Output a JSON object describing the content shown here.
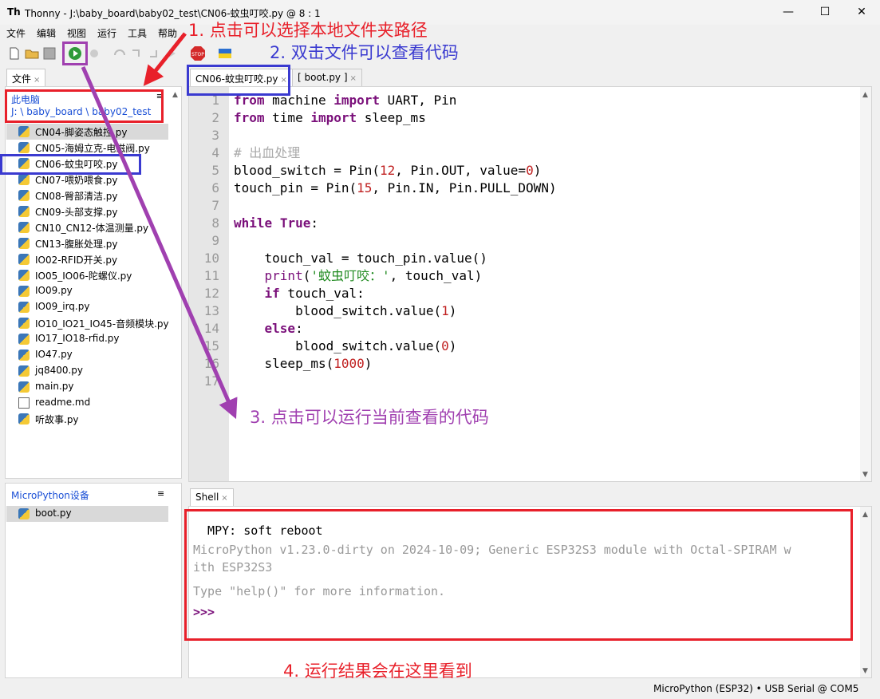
{
  "window": {
    "app_name": "Thonny",
    "title": "J:\\baby_board\\baby02_test\\CN06-蚊虫叮咬.py  @  8 : 1",
    "icon_text": "Th",
    "minimize_glyph": "—",
    "maximize_glyph": "☐",
    "close_glyph": "✕"
  },
  "menu": [
    "文件",
    "编辑",
    "视图",
    "运行",
    "工具",
    "帮助"
  ],
  "files_panel": {
    "tab_label": "文件",
    "location_label": "此电脑",
    "path": "J: \\ baby_board \\ baby02_test",
    "menu_glyph": "≡",
    "files": [
      {
        "name": "CN04-脚姿态触控.py",
        "type": "py",
        "selected": true
      },
      {
        "name": "CN05-海姆立克-电磁阀.py",
        "type": "py"
      },
      {
        "name": "CN06-蚊虫叮咬.py",
        "type": "py"
      },
      {
        "name": "CN07-喂奶喂食.py",
        "type": "py"
      },
      {
        "name": "CN08-臀部清洁.py",
        "type": "py"
      },
      {
        "name": "CN09-头部支撑.py",
        "type": "py"
      },
      {
        "name": "CN10_CN12-体温测量.py",
        "type": "py"
      },
      {
        "name": "CN13-腹胀处理.py",
        "type": "py"
      },
      {
        "name": "IO02-RFID开关.py",
        "type": "py"
      },
      {
        "name": "IO05_IO06-陀螺仪.py",
        "type": "py"
      },
      {
        "name": "IO09.py",
        "type": "py"
      },
      {
        "name": "IO09_irq.py",
        "type": "py"
      },
      {
        "name": "IO10_IO21_IO45-音频模块.py",
        "type": "py"
      },
      {
        "name": "IO17_IO18-rfid.py",
        "type": "py"
      },
      {
        "name": "IO47.py",
        "type": "py"
      },
      {
        "name": "jq8400.py",
        "type": "py"
      },
      {
        "name": "main.py",
        "type": "py"
      },
      {
        "name": "readme.md",
        "type": "md"
      },
      {
        "name": "听故事.py",
        "type": "py"
      }
    ]
  },
  "device_panel": {
    "label": "MicroPython设备",
    "menu_glyph": "≡",
    "files": [
      {
        "name": "boot.py",
        "type": "py",
        "selected": true
      }
    ]
  },
  "editor": {
    "tabs": [
      {
        "label": "CN06-蚊虫叮咬.py",
        "active": true
      },
      {
        "label": "[ boot.py ]",
        "active": false
      }
    ],
    "close_glyph": "×",
    "line_numbers": [
      "1",
      "2",
      "3",
      "4",
      "5",
      "6",
      "7",
      "8",
      "9",
      "10",
      "11",
      "12",
      "13",
      "14",
      "15",
      "16",
      "17"
    ],
    "lines": [
      [
        {
          "t": "from",
          "c": "kw"
        },
        {
          "t": " machine "
        },
        {
          "t": "import",
          "c": "kw"
        },
        {
          "t": " UART, Pin"
        }
      ],
      [
        {
          "t": "from",
          "c": "kw"
        },
        {
          "t": " time "
        },
        {
          "t": "import",
          "c": "kw"
        },
        {
          "t": " sleep_ms"
        }
      ],
      [],
      [
        {
          "t": "# 出血处理",
          "c": "cmt"
        }
      ],
      [
        {
          "t": "blood_switch = Pin("
        },
        {
          "t": "12",
          "c": "num"
        },
        {
          "t": ", Pin.OUT, value="
        },
        {
          "t": "0",
          "c": "num"
        },
        {
          "t": ")"
        }
      ],
      [
        {
          "t": "touch_pin = Pin("
        },
        {
          "t": "15",
          "c": "num"
        },
        {
          "t": ", Pin.IN, Pin.PULL_DOWN)"
        }
      ],
      [],
      [
        {
          "t": "while",
          "c": "kw"
        },
        {
          "t": " "
        },
        {
          "t": "True",
          "c": "kw"
        },
        {
          "t": ":"
        }
      ],
      [],
      [
        {
          "t": "    touch_val = touch_pin.value()"
        }
      ],
      [
        {
          "t": "    "
        },
        {
          "t": "print",
          "c": "builtin"
        },
        {
          "t": "("
        },
        {
          "t": "'蚊虫叮咬：'",
          "c": "str"
        },
        {
          "t": ", touch_val)"
        }
      ],
      [
        {
          "t": "    "
        },
        {
          "t": "if",
          "c": "kw"
        },
        {
          "t": " touch_val:"
        }
      ],
      [
        {
          "t": "        blood_switch.value("
        },
        {
          "t": "1",
          "c": "num"
        },
        {
          "t": ")"
        }
      ],
      [
        {
          "t": "    "
        },
        {
          "t": "else",
          "c": "kw"
        },
        {
          "t": ":"
        }
      ],
      [
        {
          "t": "        blood_switch.value("
        },
        {
          "t": "0",
          "c": "num"
        },
        {
          "t": ")"
        }
      ],
      [
        {
          "t": "    sleep_ms("
        },
        {
          "t": "1000",
          "c": "num"
        },
        {
          "t": ")"
        }
      ],
      []
    ]
  },
  "shell": {
    "tab_label": "Shell",
    "lines": [
      {
        "text": "  MPY: soft reboot",
        "color": "#000000"
      },
      {
        "text": "MicroPython v1.23.0-dirty on 2024-10-09; Generic ESP32S3 module with Octal-SPIRAM w",
        "color": "#999999"
      },
      {
        "text": "ith ESP32S3",
        "color": "#999999"
      },
      {
        "text": "Type \"help()\" for more information.",
        "color": "#999999"
      },
      {
        "text": ">>>",
        "color": "#7a0f7a"
      }
    ]
  },
  "annotations": {
    "a1": "1. 点击可以选择本地文件夹路径",
    "a2": "2. 双击文件可以查看代码",
    "a3": "3. 点击可以运行当前查看的代码",
    "a4": "4. 运行结果会在这里看到",
    "colors": {
      "red": "#e8202a",
      "blue": "#3a3ad0",
      "purple": "#a040b0"
    }
  },
  "statusbar": {
    "interpreter": "MicroPython (ESP32)",
    "separator": "•",
    "port": "USB Serial @ COM5"
  }
}
